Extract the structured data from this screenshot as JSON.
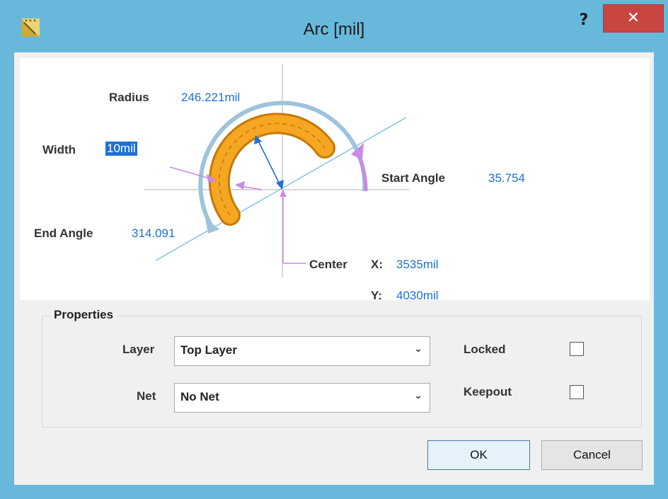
{
  "window": {
    "title": "Arc [mil]",
    "help_label": "?",
    "close_label": "✕",
    "app_icon": "ruler-pencil-icon"
  },
  "diagram": {
    "radius_label": "Radius",
    "radius_value": "246.221mil",
    "width_label": "Width",
    "width_value": "10mil",
    "start_angle_label": "Start Angle",
    "start_angle_value": "35.754",
    "end_angle_label": "End Angle",
    "end_angle_value": "314.091",
    "center_label": "Center",
    "center_x_label": "X:",
    "center_x_value": "3535mil",
    "center_y_label": "Y:",
    "center_y_value": "4030mil",
    "colors": {
      "arc_fill": "#f5a623",
      "arc_outline": "#c77800",
      "guide_arc": "#9ec3dc",
      "angle_arrow": "#c78ae6",
      "construction_line": "#7fbfe6",
      "radius_arrow": "#1e6fd6",
      "value_text": "#1e6fd6"
    }
  },
  "properties": {
    "title": "Properties",
    "layer_label": "Layer",
    "layer_value": "Top Layer",
    "net_label": "Net",
    "net_value": "No Net",
    "locked_label": "Locked",
    "locked_checked": false,
    "keepout_label": "Keepout",
    "keepout_checked": false
  },
  "buttons": {
    "ok_label": "OK",
    "cancel_label": "Cancel"
  }
}
